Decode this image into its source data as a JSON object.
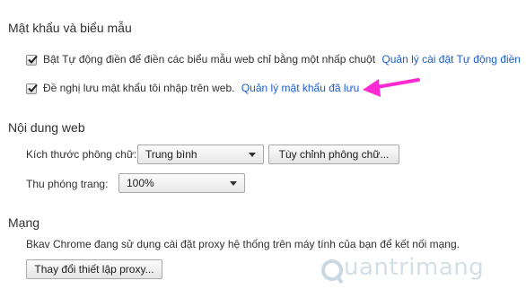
{
  "passwords": {
    "title": "Mật khẩu và biểu mẫu",
    "autofill_label": "Bật Tự động điền để điền các biểu mẫu web chỉ bằng một nhấp chuột",
    "autofill_link": "Quản lý cài đặt Tự động điền",
    "save_password_label": "Đề nghị lưu mật khẩu tôi nhập trên web.",
    "save_password_link": "Quản lý mật khẩu đã lưu"
  },
  "web_content": {
    "title": "Nội dung web",
    "font_size_label": "Kích thước phông chữ:",
    "font_size_value": "Trung bình",
    "customize_fonts_button": "Tùy chỉnh phông chữ...",
    "zoom_label": "Thu phóng trang:",
    "zoom_value": "100%"
  },
  "network": {
    "title": "Mạng",
    "description": "Bkav Chrome đang sử dụng cài đặt proxy hệ thống trên máy tính của bạn để kết nối mạng.",
    "proxy_button": "Thay đổi thiết lập proxy..."
  },
  "watermark": "uantrimang",
  "colors": {
    "arrow": "#ff2bd2",
    "link": "#1e5dc8"
  }
}
